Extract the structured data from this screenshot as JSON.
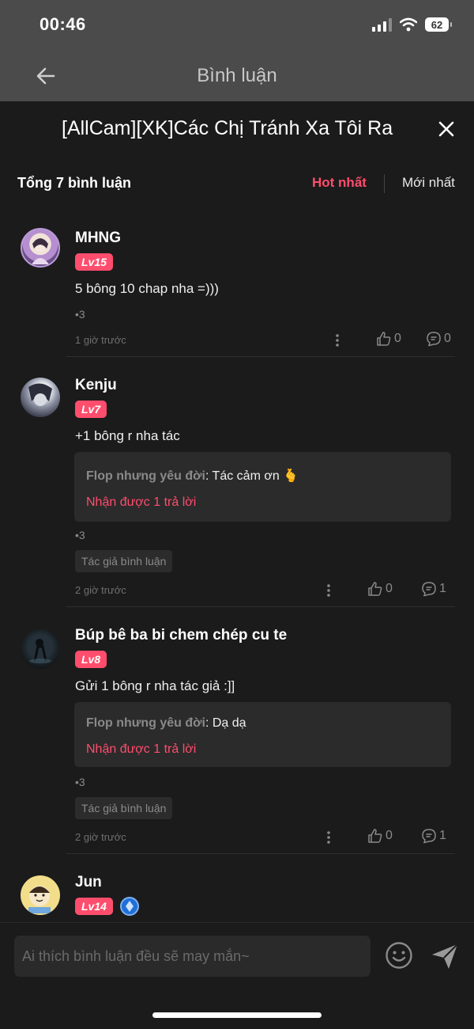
{
  "status_bar": {
    "time": "00:46",
    "battery": "62"
  },
  "nav": {
    "title": "Bình luận"
  },
  "sheet": {
    "title": "[AllCam][XK]Các Chị Tránh Xa Tôi Ra"
  },
  "comments_header": {
    "count_label": "Tổng 7 bình luận",
    "sort_hot": "Hot nhất",
    "sort_new": "Mới nhất"
  },
  "comments": [
    {
      "username": "MHNG",
      "level": "Lv15",
      "text": "5 bông 10 chap nha =)))",
      "dot_count": "•3",
      "time": "1 giờ trước",
      "likes": "0",
      "replies": "0"
    },
    {
      "username": "Kenju",
      "level": "Lv7",
      "text": "+1 bông r nha tác",
      "reply_author": "Flop nhưng yêu đời",
      "reply_text": ": Tác cảm ơn 🫰",
      "reply_count_label": "Nhận được 1 trả lời",
      "dot_count": "•3",
      "tag": "Tác giả bình luận",
      "time": "2 giờ trước",
      "likes": "0",
      "replies": "1"
    },
    {
      "username": "Búp bê ba bi chem chép cu te",
      "level": "Lv8",
      "text": "Gửi 1 bông r nha tác giả :]]",
      "reply_author": "Flop nhưng yêu đời",
      "reply_text": ": Dạ dạ",
      "reply_count_label": "Nhận được 1 trả lời",
      "dot_count": "•3",
      "tag": "Tác giả bình luận",
      "time": "2 giờ trước",
      "likes": "0",
      "replies": "1"
    },
    {
      "username": "Jun",
      "level": "Lv14"
    }
  ],
  "input": {
    "placeholder": "Ai thích bình luận đều sẽ may mắn~"
  },
  "colors": {
    "accent": "#ff4d6d",
    "background": "#1b1b1b",
    "header": "#4b4b4b"
  }
}
